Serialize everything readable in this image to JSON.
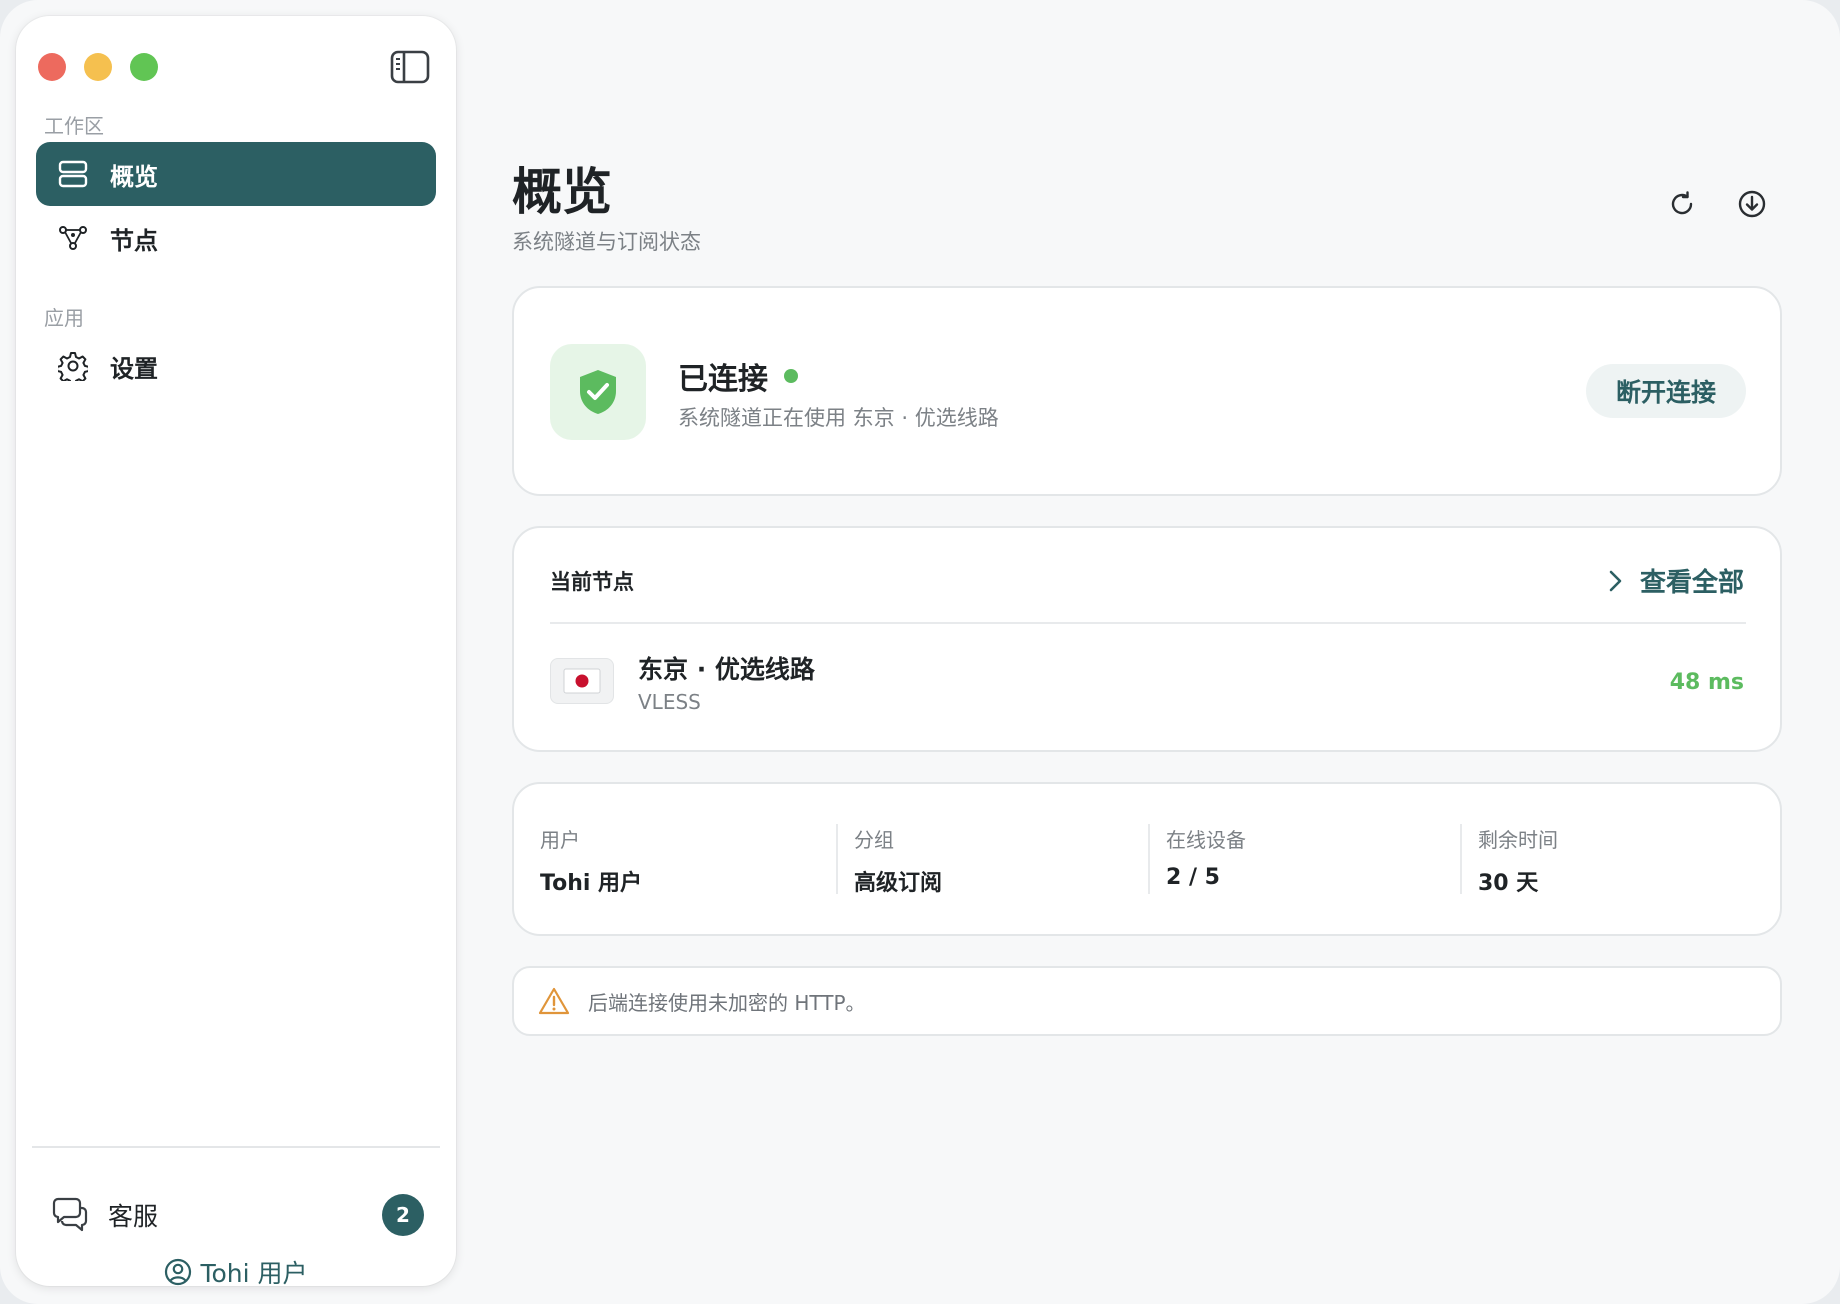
{
  "sidebar": {
    "sections": {
      "workspace": "工作区",
      "app": "应用"
    },
    "items": [
      {
        "label": "概览",
        "icon": "server-stack-icon",
        "active": true
      },
      {
        "label": "节点",
        "icon": "network-nodes-icon",
        "active": false
      },
      {
        "label": "设置",
        "icon": "gear-icon",
        "active": false
      }
    ],
    "support": {
      "label": "客服",
      "icon": "chat-bubbles-icon",
      "badge": "2"
    },
    "user": {
      "label": "Tohi 用户",
      "icon": "user-circle-icon"
    }
  },
  "header": {
    "title": "概览",
    "subtitle": "系统隧道与订阅状态",
    "actions": [
      "refresh-icon",
      "download-icon"
    ]
  },
  "status": {
    "title": "已连接",
    "description": "系统隧道正在使用 东京 · 优选线路",
    "button": "断开连接",
    "icon": "shield-check-icon",
    "color": "#5cbb5f"
  },
  "current_node": {
    "header": "当前节点",
    "view_all": "查看全部",
    "name": "东京 · 优选线路",
    "protocol": "VLESS",
    "latency": "48 ms",
    "flag": "japan-flag-icon"
  },
  "stats": [
    {
      "label": "用户",
      "value": "Tohi 用户"
    },
    {
      "label": "分组",
      "value": "高级订阅"
    },
    {
      "label": "在线设备",
      "value": "2 / 5"
    },
    {
      "label": "剩余时间",
      "value": "30 天"
    }
  ],
  "warning": {
    "text": "后端连接使用未加密的 HTTP。",
    "icon": "warning-triangle-icon"
  },
  "colors": {
    "accent": "#2c5f63",
    "success": "#5cbb5f",
    "warning": "#e0953a"
  }
}
